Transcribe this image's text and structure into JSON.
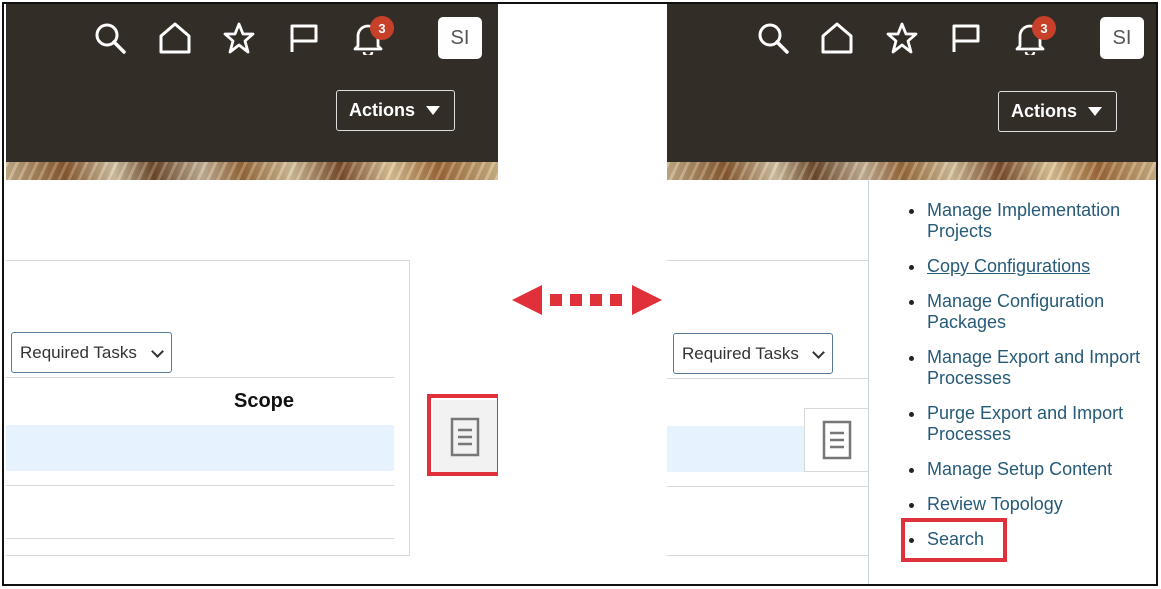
{
  "header": {
    "notification_count": "3",
    "avatar_initials": "SI",
    "actions_label": "Actions"
  },
  "content": {
    "dropdown_value": "Required Tasks",
    "scope_header": "Scope"
  },
  "task_panel": {
    "items": [
      "Manage Implementation Projects",
      "Copy Configurations",
      "Manage Configuration Packages",
      "Manage Export and Import Processes",
      "Purge Export and Import Processes",
      "Manage Setup Content",
      "Review Topology",
      "Search"
    ]
  },
  "icons": [
    "search-icon",
    "home-icon",
    "star-icon",
    "flag-icon",
    "bell-icon",
    "tasks-icon",
    "double-arrow-icon"
  ],
  "colors": {
    "header_bg": "#332d28",
    "link": "#265a78",
    "highlight": "#e0303a",
    "badge": "#c7402a",
    "row_highlight": "#e6f2fd"
  }
}
